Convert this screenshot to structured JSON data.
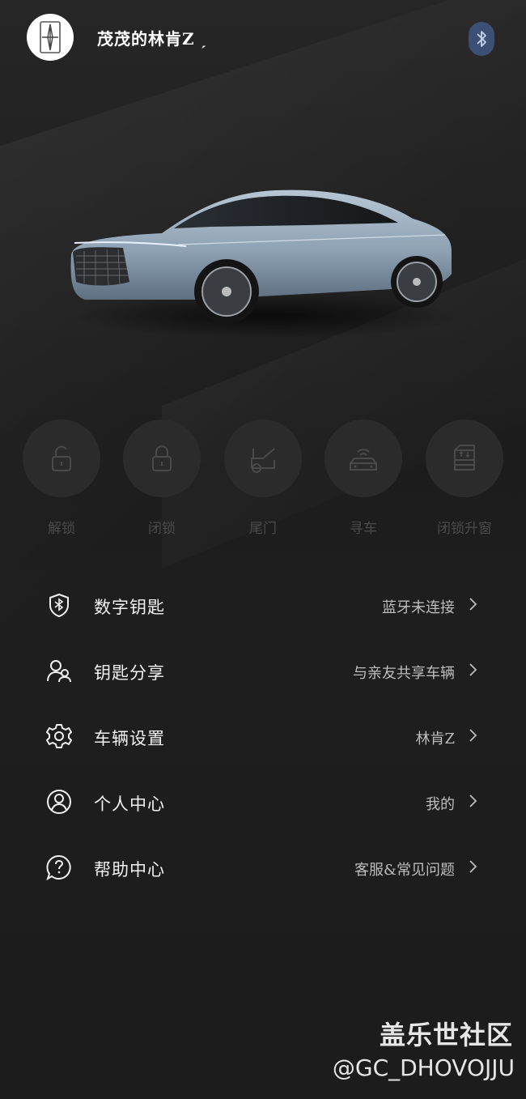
{
  "header": {
    "vehicle_title": "茂茂的林肯Z ˏ",
    "logo_icon": "lincoln-star-logo",
    "bluetooth_icon": "bluetooth-icon",
    "bluetooth_color": "#3c4f74"
  },
  "car_image": "car-image",
  "actions": [
    {
      "label": "解锁",
      "icon": "unlock-icon"
    },
    {
      "label": "闭锁",
      "icon": "lock-icon"
    },
    {
      "label": "尾门",
      "icon": "tailgate-icon"
    },
    {
      "label": "寻车",
      "icon": "find-car-icon"
    },
    {
      "label": "闭锁升窗",
      "icon": "lock-raise-window-icon"
    }
  ],
  "menu": [
    {
      "label": "数字钥匙",
      "value": "蓝牙未连接",
      "icon": "bluetooth-shield-icon"
    },
    {
      "label": "钥匙分享",
      "value": "与亲友共享车辆",
      "icon": "share-users-icon"
    },
    {
      "label": "车辆设置",
      "value": "林肯Z",
      "icon": "gear-icon"
    },
    {
      "label": "个人中心",
      "value": "我的",
      "icon": "user-circle-icon"
    },
    {
      "label": "帮助中心",
      "value": "客服&常见问题",
      "icon": "help-bubble-icon"
    }
  ],
  "watermark": {
    "line1": "盖乐世社区",
    "line2": "@GC_DHOVOJJU"
  }
}
